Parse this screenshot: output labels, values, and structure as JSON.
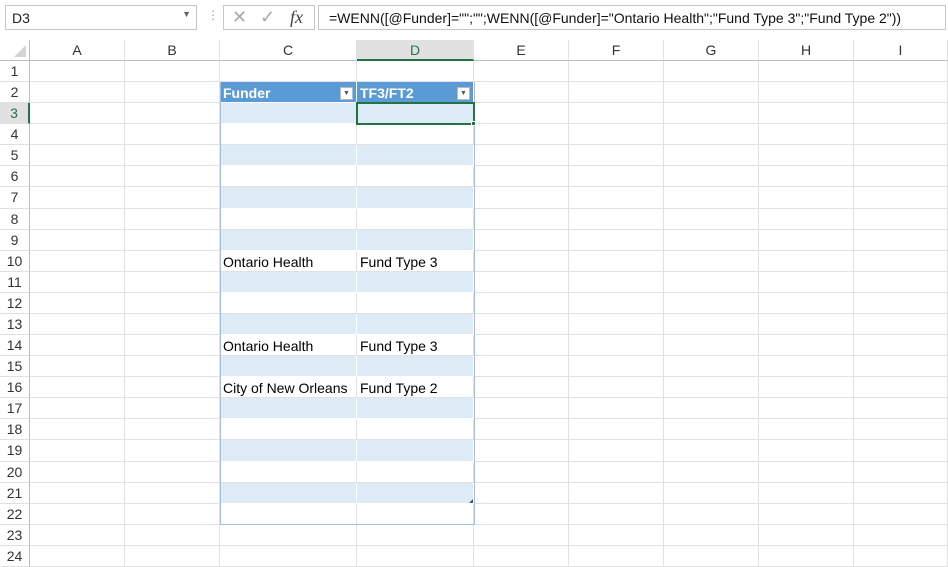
{
  "name_box": "D3",
  "formula": "=WENN([@Funder]=\"\";\"\";WENN([@Funder]=\"Ontario Health\";\"Fund Type 3\";\"Fund Type 2\"))",
  "fx_label": "fx",
  "columns": [
    "A",
    "B",
    "C",
    "D",
    "E",
    "F",
    "G",
    "H",
    "I"
  ],
  "active_column": "D",
  "active_row": 3,
  "row_count": 24,
  "table": {
    "header_row": 2,
    "headers": [
      "Funder",
      "TF3/FT2"
    ],
    "rows": [
      {
        "row": 3,
        "funder": "",
        "type": ""
      },
      {
        "row": 4,
        "funder": "",
        "type": ""
      },
      {
        "row": 5,
        "funder": "",
        "type": ""
      },
      {
        "row": 6,
        "funder": "",
        "type": ""
      },
      {
        "row": 7,
        "funder": "",
        "type": ""
      },
      {
        "row": 8,
        "funder": "",
        "type": ""
      },
      {
        "row": 9,
        "funder": "",
        "type": ""
      },
      {
        "row": 10,
        "funder": "Ontario Health",
        "type": "Fund Type 3"
      },
      {
        "row": 11,
        "funder": "",
        "type": ""
      },
      {
        "row": 12,
        "funder": "",
        "type": ""
      },
      {
        "row": 13,
        "funder": "",
        "type": ""
      },
      {
        "row": 14,
        "funder": "Ontario Health",
        "type": "Fund Type 3"
      },
      {
        "row": 15,
        "funder": "",
        "type": ""
      },
      {
        "row": 16,
        "funder": "City of New Orleans",
        "type": "Fund Type 2"
      },
      {
        "row": 17,
        "funder": "",
        "type": ""
      },
      {
        "row": 18,
        "funder": "",
        "type": ""
      },
      {
        "row": 19,
        "funder": "",
        "type": ""
      },
      {
        "row": 20,
        "funder": "",
        "type": ""
      },
      {
        "row": 21,
        "funder": "",
        "type": ""
      },
      {
        "row": 22,
        "funder": "",
        "type": ""
      }
    ]
  },
  "colors": {
    "accent": "#217346",
    "table_header": "#5b9bd5",
    "band": "#ddebf7"
  }
}
